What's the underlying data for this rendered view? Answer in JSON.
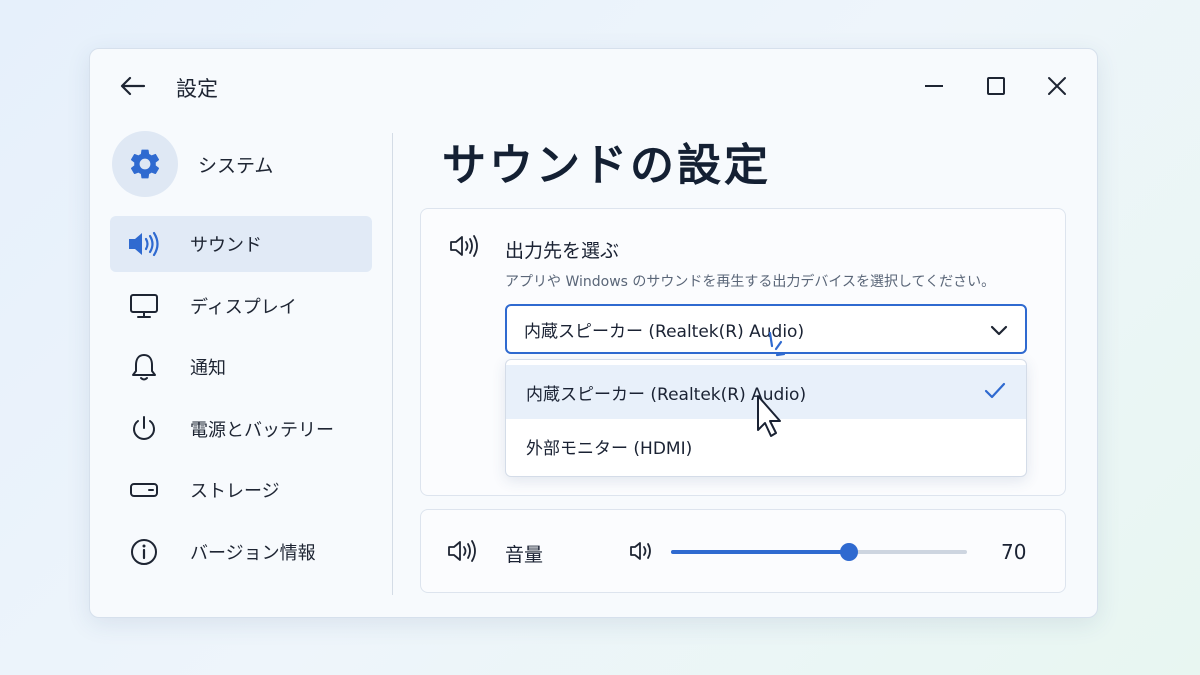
{
  "window": {
    "title": "設定"
  },
  "profile": {
    "label": "システム",
    "icon": "gear-icon"
  },
  "sidebar": {
    "items": [
      {
        "label": "サウンド",
        "icon": "speaker-icon",
        "active": true
      },
      {
        "label": "ディスプレイ",
        "icon": "monitor-icon",
        "active": false
      },
      {
        "label": "通知",
        "icon": "bell-icon",
        "active": false
      },
      {
        "label": "電源とバッテリー",
        "icon": "power-icon",
        "active": false
      },
      {
        "label": "ストレージ",
        "icon": "storage-icon",
        "active": false
      },
      {
        "label": "バージョン情報",
        "icon": "info-icon",
        "active": false
      }
    ]
  },
  "page": {
    "title": "サウンドの設定"
  },
  "output": {
    "title": "出力先を選ぶ",
    "description": "アプリや Windows のサウンドを再生する出力デバイスを選択してください。",
    "selected": "内蔵スピーカー (Realtek(R) Audio)",
    "options": [
      {
        "label": "内蔵スピーカー (Realtek(R) Audio)",
        "selected": true
      },
      {
        "label": "外部モニター (HDMI)",
        "selected": false
      }
    ]
  },
  "volume": {
    "label": "音量",
    "value": "70",
    "level": 0.6
  },
  "colors": {
    "accent": "#2f6ad0",
    "text": "#1a2233"
  }
}
